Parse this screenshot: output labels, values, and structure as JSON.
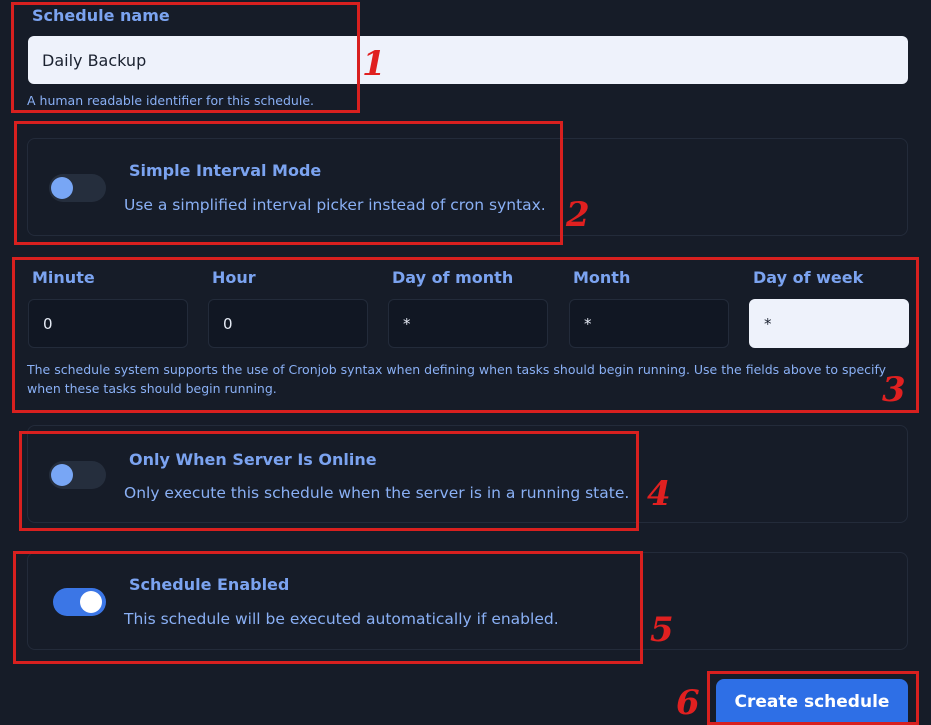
{
  "schedule_name": {
    "label": "Schedule name",
    "value": "Daily Backup",
    "help": "A human readable identifier for this schedule."
  },
  "simple_interval": {
    "title": "Simple Interval Mode",
    "description": "Use a simplified interval picker instead of cron syntax.",
    "enabled": false
  },
  "cron": {
    "fields": [
      {
        "label": "Minute",
        "value": "0"
      },
      {
        "label": "Hour",
        "value": "0"
      },
      {
        "label": "Day of month",
        "value": "*"
      },
      {
        "label": "Month",
        "value": "*"
      },
      {
        "label": "Day of week",
        "value": "*"
      }
    ],
    "help": "The schedule system supports the use of Cronjob syntax when defining when tasks should begin running. Use the fields above to specify when these tasks should begin running."
  },
  "only_online": {
    "title": "Only When Server Is Online",
    "description": "Only execute this schedule when the server is in a running state.",
    "enabled": false
  },
  "schedule_enabled": {
    "title": "Schedule Enabled",
    "description": "This schedule will be executed automatically if enabled.",
    "enabled": true
  },
  "create_button": {
    "label": "Create schedule"
  },
  "annotations": [
    "1",
    "2",
    "3",
    "4",
    "5",
    "6"
  ],
  "colors": {
    "background": "#161c28",
    "label_blue": "#7ba3f0",
    "button_blue": "#2e6fe6",
    "annotation_red": "#d8201f"
  }
}
